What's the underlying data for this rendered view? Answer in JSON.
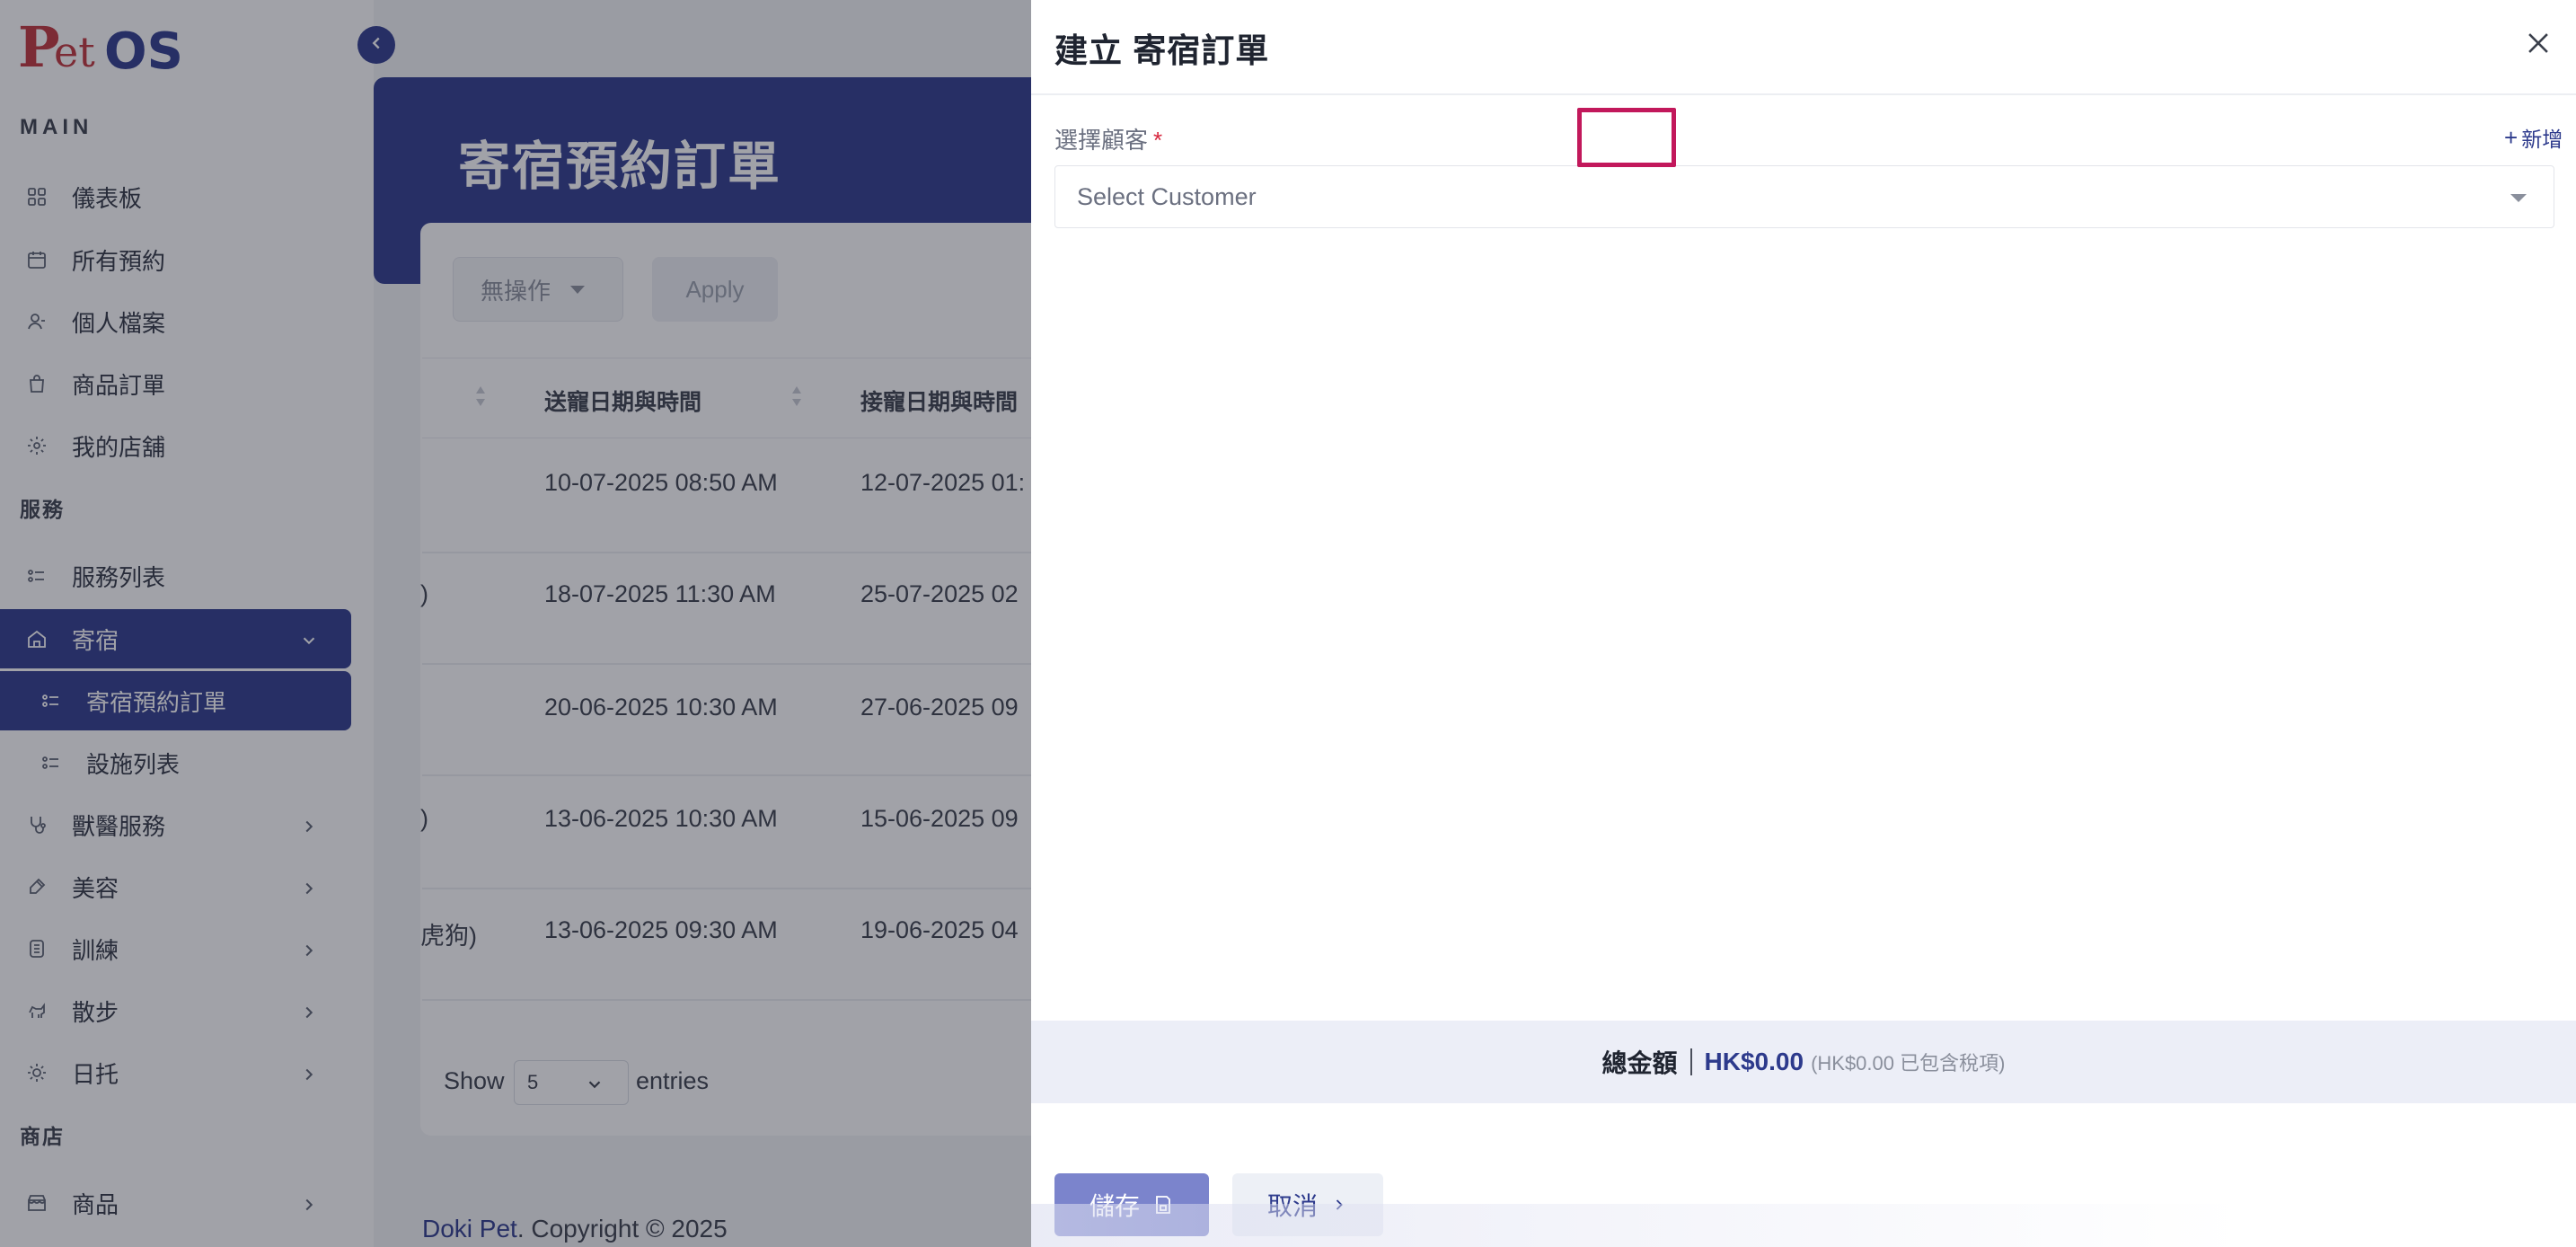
{
  "sidebar": {
    "logo_text": "PetOS",
    "section_main": "MAIN",
    "section_services": "服務",
    "section_shop": "商店",
    "items": {
      "dashboard": "儀表板",
      "all_bookings": "所有預約",
      "profile": "個人檔案",
      "product_orders": "商品訂單",
      "my_store": "我的店舖",
      "service_list": "服務列表",
      "boarding": "寄宿",
      "boarding_orders": "寄宿預約訂單",
      "facility_list": "設施列表",
      "vet_services": "獸醫服務",
      "grooming": "美容",
      "training": "訓練",
      "walking": "散步",
      "daycare": "日托",
      "products": "商品"
    }
  },
  "main": {
    "page_title": "寄宿預約訂單",
    "bulk_action": "無操作",
    "apply_label": "Apply",
    "columns": {
      "dropoff": "送寵日期與時間",
      "pickup": "接寵日期與時間"
    },
    "rows": [
      {
        "prefix": "",
        "dropoff": "10-07-2025 08:50 AM",
        "pickup": "12-07-2025 01:"
      },
      {
        "prefix": ")",
        "dropoff": "18-07-2025 11:30 AM",
        "pickup": "25-07-2025 02"
      },
      {
        "prefix": "",
        "dropoff": "20-06-2025 10:30 AM",
        "pickup": "27-06-2025 09"
      },
      {
        "prefix": ")",
        "dropoff": "13-06-2025 10:30 AM",
        "pickup": "15-06-2025 09"
      },
      {
        "prefix": "虎狗)",
        "dropoff": "13-06-2025 09:30 AM",
        "pickup": "19-06-2025 04"
      }
    ],
    "show_label": "Show",
    "page_size": "5",
    "entries_label": "entries",
    "footer_brand": "Doki Pet",
    "footer_copy": ". Copyright © 2025"
  },
  "drawer": {
    "title": "建立 寄宿訂單",
    "customer_label": "選擇顧客",
    "required_mark": "*",
    "add_label": "新增",
    "customer_placeholder": "Select Customer",
    "total_label": "總金額",
    "total_amount": "HK$0.00",
    "total_tax_note": "(HK$0.00 已包含稅項)",
    "save_label": "儲存",
    "cancel_label": "取消"
  },
  "colors": {
    "primary": "#2d3a8c",
    "highlight": "#c2185b",
    "save_button": "#7b84cc"
  }
}
